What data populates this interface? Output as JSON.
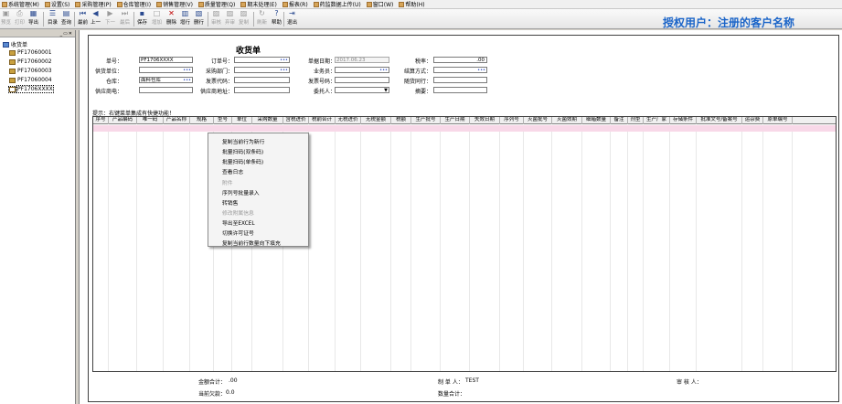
{
  "menu": [
    {
      "label": "系统管理(M)"
    },
    {
      "label": "设置(S)"
    },
    {
      "label": "采购管理(P)"
    },
    {
      "label": "仓库管理(I)"
    },
    {
      "label": "销售管理(V)"
    },
    {
      "label": "质量管理(Q)"
    },
    {
      "label": "期末处理(E)"
    },
    {
      "label": "报表(R)"
    },
    {
      "label": "药监数据上传(U)"
    },
    {
      "label": "窗口(W)"
    },
    {
      "label": "帮助(H)"
    }
  ],
  "toolbar": [
    {
      "label": "预览",
      "icon": "preview-icon",
      "glyph": "▣",
      "enabled": false
    },
    {
      "label": "打印",
      "icon": "print-icon",
      "glyph": "⎙",
      "enabled": false
    },
    {
      "label": "导出",
      "icon": "export-icon",
      "glyph": "▦",
      "enabled": true
    },
    {
      "label": "目录",
      "icon": "catalog-icon",
      "glyph": "☰",
      "enabled": true
    },
    {
      "label": "查询",
      "icon": "search-icon",
      "glyph": "▤",
      "enabled": true
    },
    {
      "label": "最前",
      "icon": "first-icon",
      "glyph": "⏮",
      "enabled": true
    },
    {
      "label": "上一",
      "icon": "prev-icon",
      "glyph": "◀",
      "enabled": true
    },
    {
      "label": "下一",
      "icon": "next-icon",
      "glyph": "▶",
      "enabled": false
    },
    {
      "label": "最后",
      "icon": "last-icon",
      "glyph": "⏭",
      "enabled": false
    },
    {
      "label": "保存",
      "icon": "save-icon",
      "glyph": "▪",
      "enabled": true
    },
    {
      "label": "增加",
      "icon": "add-icon",
      "glyph": "□",
      "enabled": false
    },
    {
      "label": "删除",
      "icon": "delete-icon",
      "glyph": "✕",
      "enabled": true
    },
    {
      "label": "增行",
      "icon": "add-row-icon",
      "glyph": "▥",
      "enabled": true
    },
    {
      "label": "删行",
      "icon": "delete-row-icon",
      "glyph": "▧",
      "enabled": true
    },
    {
      "label": "审核",
      "icon": "audit-icon",
      "glyph": "▨",
      "enabled": false
    },
    {
      "label": "弃审",
      "icon": "unaudit-icon",
      "glyph": "▨",
      "enabled": false
    },
    {
      "label": "复制",
      "icon": "copy-icon",
      "glyph": "▨",
      "enabled": false
    },
    {
      "label": "刷新",
      "icon": "refresh-icon",
      "glyph": "↻",
      "enabled": false
    },
    {
      "label": "帮助",
      "icon": "help-icon",
      "glyph": "?",
      "enabled": true
    },
    {
      "label": "退出",
      "icon": "exit-icon",
      "glyph": "⇥",
      "enabled": true
    }
  ],
  "brand": "授权用户：注册的客户名称",
  "tree": {
    "root": "收货单",
    "items": [
      "PF17060001",
      "PF17060002",
      "PF17060003",
      "PF17060004",
      "PF1706XXXX"
    ]
  },
  "form": {
    "title": "收货单",
    "order_no_label": "单号：",
    "order_no": "PF1706XXXX",
    "po_no_label": "订单号：",
    "po_no": "",
    "date_label": "单据日期：",
    "date": "2017.06.23",
    "tax_rate_label": "税率：",
    "tax_rate": ".00",
    "supplier_label": "供货单位：",
    "supplier": "",
    "purchase_dept_label": "采购部门：",
    "purchase_dept": "",
    "salesman_label": "业务员：",
    "salesman": "",
    "settle_label": "结算方式：",
    "settle": "",
    "warehouse_label": "仓库：",
    "warehouse": "面料仓库",
    "invoice_code_label": "发票代码：",
    "invoice_code": "",
    "invoice_no_label": "发票号码：",
    "invoice_no": "",
    "arrival_label": "随货同行：",
    "arrival": "",
    "supplier_phone_label": "供应商电：",
    "supplier_phone": "",
    "supplier_addr_label": "供应商地址：",
    "supplier_addr": "",
    "consignor_label": "委托人：",
    "consignor": "",
    "summary_label": "摘要：",
    "summary": ""
  },
  "hint": "提示：右键菜单集成有快捷功能！",
  "columns": [
    "序号",
    "产品编码",
    "唯一码",
    "产品名称",
    "规格",
    "型号",
    "单位",
    "采购数量",
    "含税进价",
    "税前合计",
    "无税进价",
    "无税金额",
    "税额",
    "生产批号",
    "生产日期",
    "失效日期",
    "序列号",
    "灭菌批号",
    "灭菌效期",
    "细箱数量",
    "备注",
    "剂型",
    "生产厂家",
    "存储条件",
    "批准文号/备案号",
    "运杂费",
    "原单编号"
  ],
  "context_menu": [
    {
      "label": "复制当前行为新行",
      "enabled": true
    },
    {
      "label": "批量扫码(双条码)",
      "enabled": true
    },
    {
      "label": "批量扫码(单条码)",
      "enabled": true
    },
    {
      "label": "查看日志",
      "enabled": true
    },
    {
      "label": "附件",
      "enabled": false
    },
    {
      "label": "序列号批量录入",
      "enabled": true
    },
    {
      "label": "转销售",
      "enabled": true
    },
    {
      "label": "修改附属信息",
      "enabled": false
    },
    {
      "label": "导出至EXCEL",
      "enabled": true
    },
    {
      "label": "切换许可证号",
      "enabled": true
    },
    {
      "label": "复制当前行数量向下填充",
      "enabled": true
    }
  ],
  "footer": {
    "amount_total_label": "金额合计：",
    "amount_total": ".00",
    "maker_label": "制 单 人：",
    "maker": "TEST",
    "auditor_label": "审 核 人：",
    "auditor": "",
    "current_debt_label": "当前欠款：",
    "current_debt": "0.0",
    "qty_total_label": "数量合计：",
    "qty_total": ""
  },
  "colors": {
    "brand": "#1a64c8",
    "row_highlight": "#f8d8e8",
    "lookup_dots": "#3050c0"
  }
}
